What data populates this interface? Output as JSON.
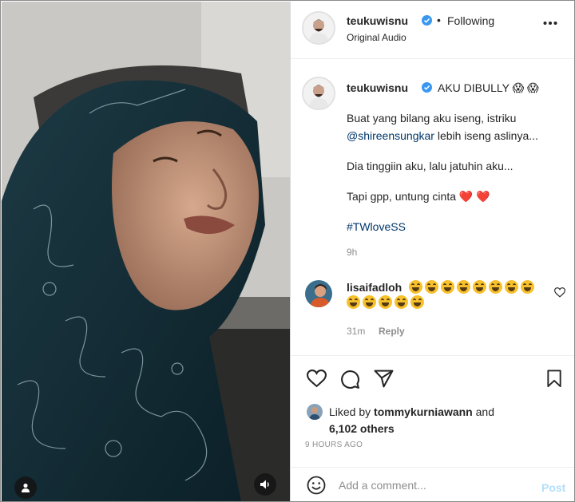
{
  "post": {
    "author": "teukuwisnu",
    "follow_status": "Following",
    "separator": "•",
    "audio": "Original Audio",
    "more_icon": "more-horizontal-icon"
  },
  "caption": {
    "author": "teukuwisnu",
    "title": "AKU DIBULLY 😱 😱",
    "line1": "Buat yang bilang aku iseng, istriku",
    "mention": "@shireensungkar",
    "line2_rest": " lebih iseng aslinya...",
    "line3": "Dia tinggiin aku, lalu jatuhin aku...",
    "line4": "Tapi gpp, untung cinta ❤️ ❤️",
    "hashtag": "#TWloveSS",
    "time": "9h"
  },
  "comment": {
    "user": "lisaifadloh",
    "emoji_count_row1": 8,
    "emoji_count_row2": 5,
    "time": "31m",
    "reply_label": "Reply"
  },
  "likes": {
    "prefix": "Liked by",
    "user": "tommykurniawann",
    "and": "and",
    "others": "6,102 others"
  },
  "posted_time": "9 HOURS AGO",
  "composer": {
    "placeholder": "Add a comment...",
    "post_label": "Post"
  },
  "colors": {
    "accent": "#0095f6",
    "post_disabled": "#b2dffc",
    "heart_red": "#ed4956",
    "link": "#00376b",
    "verified": "#3897f0"
  }
}
